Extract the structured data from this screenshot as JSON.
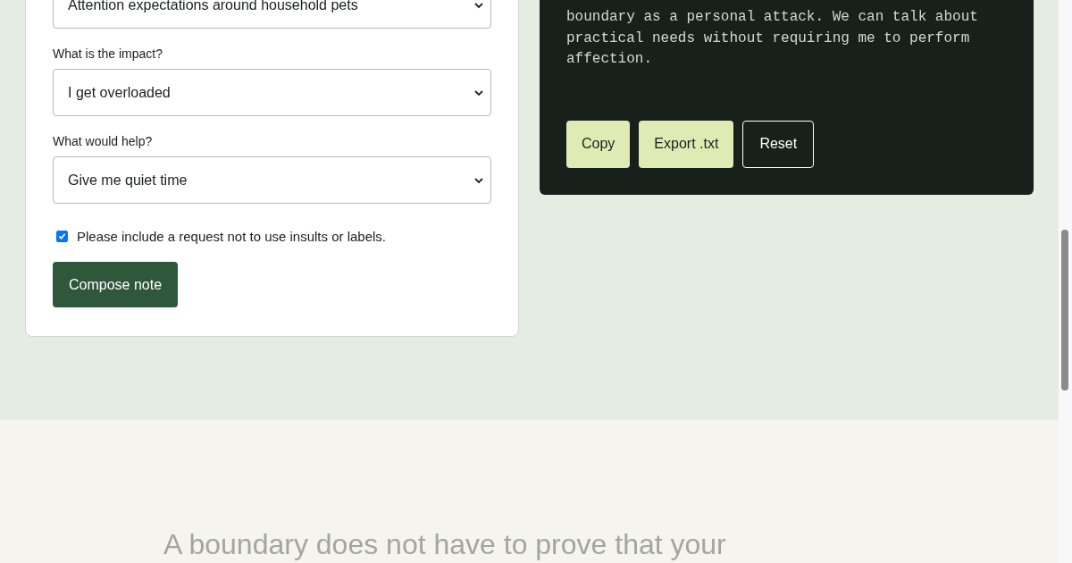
{
  "form": {
    "fields": [
      {
        "kind": "select",
        "value": "Attention expectations around household pets"
      },
      {
        "kind": "select",
        "label": "What is the impact?",
        "value": "I get overloaded"
      },
      {
        "kind": "select",
        "label": "What would help?",
        "value": "Give me quiet time"
      },
      {
        "kind": "checkbox",
        "label": "Please include a request not to use insults or labels.",
        "checked": true
      }
    ],
    "submit": "Compose note"
  },
  "note": {
    "text": "boundary as a personal attack. We can talk about practical needs without requiring me to perform affection.",
    "buttons": [
      {
        "label": "Copy",
        "kind": "primary"
      },
      {
        "label": "Export .txt",
        "kind": "primary"
      },
      {
        "label": "Reset",
        "kind": "outline"
      }
    ]
  },
  "quote": {
    "heading": "A boundary does not have to prove that your"
  }
}
